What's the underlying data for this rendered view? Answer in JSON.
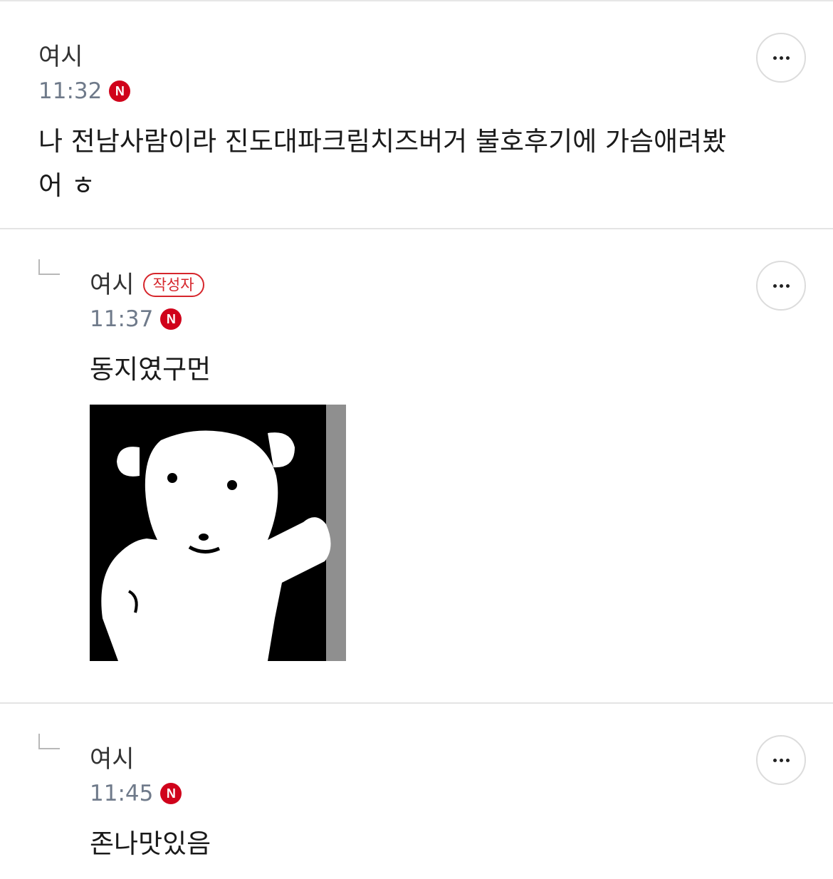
{
  "comments": [
    {
      "author": "여시",
      "time": "11:32",
      "new_badge": "N",
      "text_lines": [
        "나 전남사람이라 진도대파크림치즈버거 불호후기에 가슴애려봤",
        "어 ㅎ"
      ],
      "is_reply": false,
      "writer_badge": ""
    },
    {
      "author": "여시",
      "time": "11:37",
      "new_badge": "N",
      "text": "동지였구먼",
      "is_reply": true,
      "writer_badge": "작성자",
      "sticker": "white-bear-sticker"
    },
    {
      "author": "여시",
      "time": "11:45",
      "new_badge": "N",
      "text": "존나맛있음",
      "is_reply": true,
      "writer_badge": ""
    }
  ],
  "icons": {
    "more": "more-options-icon",
    "reply": "reply-arrow-icon",
    "new": "new-badge-icon"
  },
  "colors": {
    "accent_red": "#d0021b",
    "writer_badge": "#d6262c",
    "time_gray": "#6f7a8a"
  }
}
